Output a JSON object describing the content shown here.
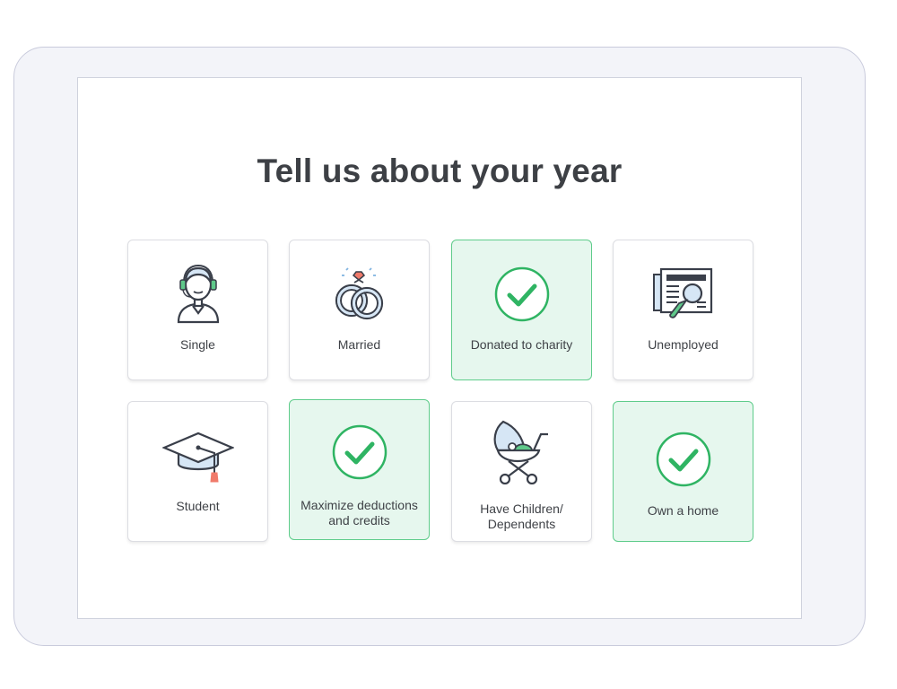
{
  "page": {
    "title": "Tell us about your year"
  },
  "options": [
    {
      "label": "Single",
      "selected": false,
      "icon": "person-headset-icon"
    },
    {
      "label": "Married",
      "selected": false,
      "icon": "wedding-rings-icon"
    },
    {
      "label": "Donated to charity",
      "selected": true,
      "icon": "checkmark-circle-icon"
    },
    {
      "label": "Unemployed",
      "selected": false,
      "icon": "newspaper-magnifier-icon"
    },
    {
      "label": "Student",
      "selected": false,
      "icon": "graduation-cap-icon"
    },
    {
      "label": "Maximize deductions and credits",
      "selected": true,
      "icon": "checkmark-circle-icon"
    },
    {
      "label": "Have Children/ Dependents",
      "selected": false,
      "icon": "baby-stroller-icon"
    },
    {
      "label": "Own a home",
      "selected": true,
      "icon": "checkmark-circle-icon"
    }
  ],
  "colors": {
    "accent": "#2fb463",
    "selected_bg": "#e6f7ee",
    "selected_border": "#5fcc8b",
    "icon_stroke": "#3a3f4a",
    "icon_fill_blue": "#d6e6f5",
    "icon_fill_green": "#5fc98a",
    "icon_fill_red": "#f07a6a"
  }
}
